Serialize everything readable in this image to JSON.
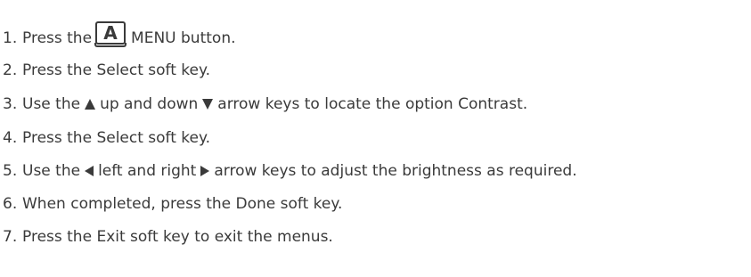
{
  "steps": [
    {
      "num": "1.",
      "before": "Press the",
      "icon_label": "A",
      "after": "MENU button."
    },
    {
      "num": "2.",
      "text": "Press the Select soft key."
    },
    {
      "num": "3.",
      "before": "Use the",
      "middle": "up and down",
      "after": "arrow keys to locate the option Contrast."
    },
    {
      "num": "4.",
      "text": "Press the Select soft key."
    },
    {
      "num": "5.",
      "before": "Use the",
      "middle": "left and right",
      "after": "arrow keys to adjust the brightness as required."
    },
    {
      "num": "6.",
      "text": "When completed, press the Done soft key."
    },
    {
      "num": "7.",
      "text": "Press the Exit soft key to exit the menus."
    }
  ],
  "icons": {
    "menu_key": "menu-key-icon",
    "up": "arrow-up-icon",
    "down": "arrow-down-icon",
    "left": "arrow-left-icon",
    "right": "arrow-right-icon"
  },
  "colors": {
    "text": "#3a3a3a",
    "background": "#ffffff"
  }
}
